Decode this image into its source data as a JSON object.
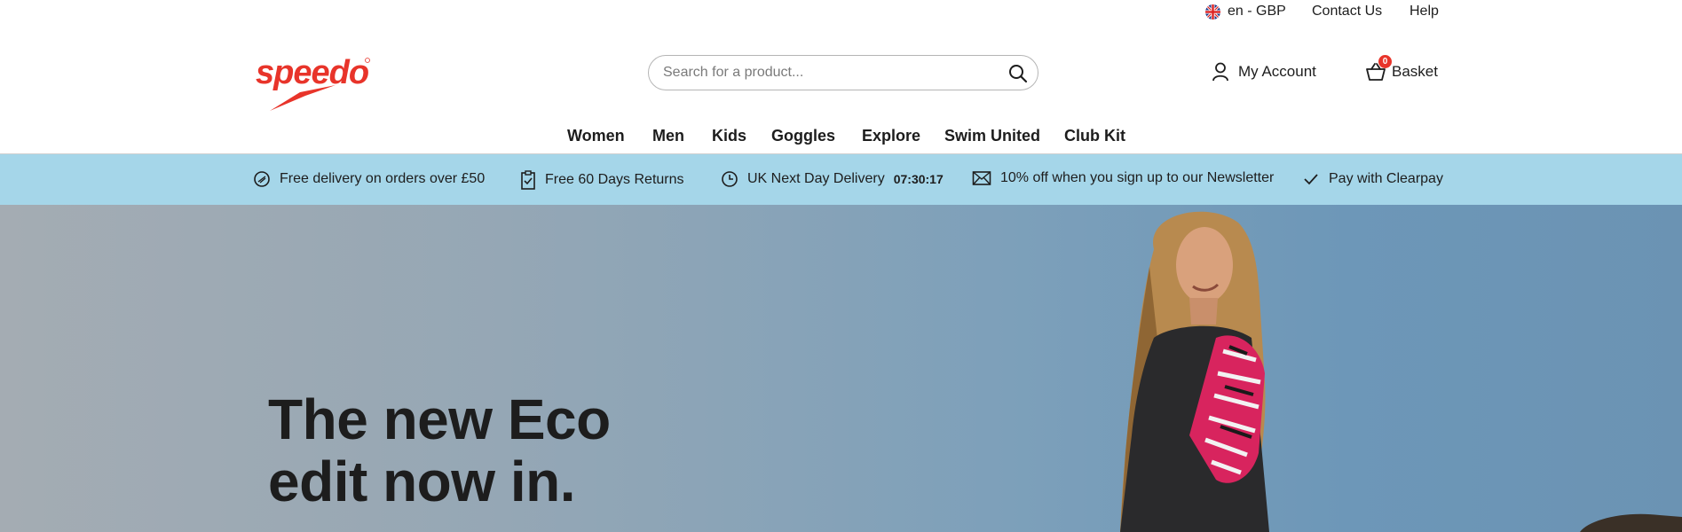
{
  "utility": {
    "locale": "en - GBP",
    "contact": "Contact Us",
    "help": "Help"
  },
  "brand": {
    "name": "speedo",
    "color": "#e8342a"
  },
  "search": {
    "placeholder": "Search for a product..."
  },
  "account": {
    "label": "My Account"
  },
  "basket": {
    "label": "Basket",
    "count": "0"
  },
  "nav": {
    "items": [
      "Women",
      "Men",
      "Kids",
      "Goggles",
      "Explore",
      "Swim United",
      "Club Kit"
    ]
  },
  "usp": {
    "items": [
      {
        "text": "Free delivery on orders over £50",
        "icon": "badge-icon"
      },
      {
        "text": "Free 60 Days Returns",
        "icon": "clipboard-check-icon"
      },
      {
        "text": "UK Next Day Delivery",
        "extra": "07:30:17",
        "icon": "clock-icon"
      },
      {
        "text": "10% off when you sign up to our Newsletter",
        "icon": "mail-icon"
      },
      {
        "text": "Pay with Clearpay",
        "icon": "check-icon"
      }
    ],
    "background": "#a5d6e9"
  },
  "hero": {
    "line1": "The new Eco",
    "line2": "edit now in."
  }
}
